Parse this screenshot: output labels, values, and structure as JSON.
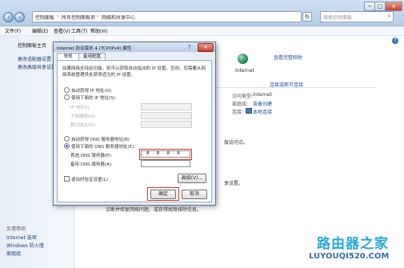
{
  "address": {
    "crumbs": [
      "控制面板",
      "所有控制面板项",
      "网络和共享中心"
    ],
    "search_placeholder": "搜索控制面板"
  },
  "window_buttons": [
    "−",
    "□",
    "×"
  ],
  "menubar": [
    "文件(F)",
    "编辑(E)",
    "查看(V)",
    "工具(T)",
    "帮助(H)"
  ],
  "left_pane": {
    "items": [
      "控制面板主页",
      "更改适配器设置",
      "更改高级共享设置"
    ],
    "see_also_title": "另请参阅",
    "see_also": [
      "Internet 选项",
      "Windows 防火墙",
      "家庭组"
    ]
  },
  "right_pane": {
    "see_full_map": "查看完整映射",
    "internet_label": "Internet",
    "connect_disconnect": "连接或断开连接",
    "access_type_label": "访问类型:",
    "access_type_value": "Internet",
    "homegroup_label": "家庭组:",
    "homegroup_value": "准备创建",
    "connections_label": "连接:",
    "connections_value": "本地连接",
    "snippet_access_point": "接访问点。",
    "snippet_sharing": "享设置。",
    "snippet_troubleshoot": "诊断并修复网络问题，或获得故障排除信息。"
  },
  "dialog": {
    "title": "Internet 协议版本 4 (TCP/IPv4) 属性",
    "tabs": [
      "常规",
      "备用配置"
    ],
    "description": "如果网络支持此功能，则可以获取自动指派的 IP 设置。否则，您需要从网络系统管理员处获得适当的 IP 设置。",
    "auto_ip": "自动获得 IP 地址(O)",
    "manual_ip": "使用下面的 IP 地址(S):",
    "ip_label": "IP 地址(I):",
    "subnet_label": "子网掩码(U):",
    "gateway_label": "默认网关(D):",
    "auto_dns": "自动获得 DNS 服务器地址(B)",
    "manual_dns": "使用下面的 DNS 服务器地址(E):",
    "preferred_dns_label": "首选 DNS 服务器(P):",
    "preferred_dns_value": "8 . 8 . 8 . 8",
    "alternate_dns_label": "备用 DNS 服务器(A):",
    "validate_label": "退出时验证设置(L)",
    "advanced": "高级(V)...",
    "ok": "确定",
    "cancel": "取消"
  },
  "watermark": {
    "text": "路由器之家",
    "url": "LUYOUQI520.COM"
  },
  "colors": {
    "annotation_red": "#d23a2a",
    "watermark_cyan": "#27a8d8",
    "link_blue": "#1d4f9c"
  }
}
